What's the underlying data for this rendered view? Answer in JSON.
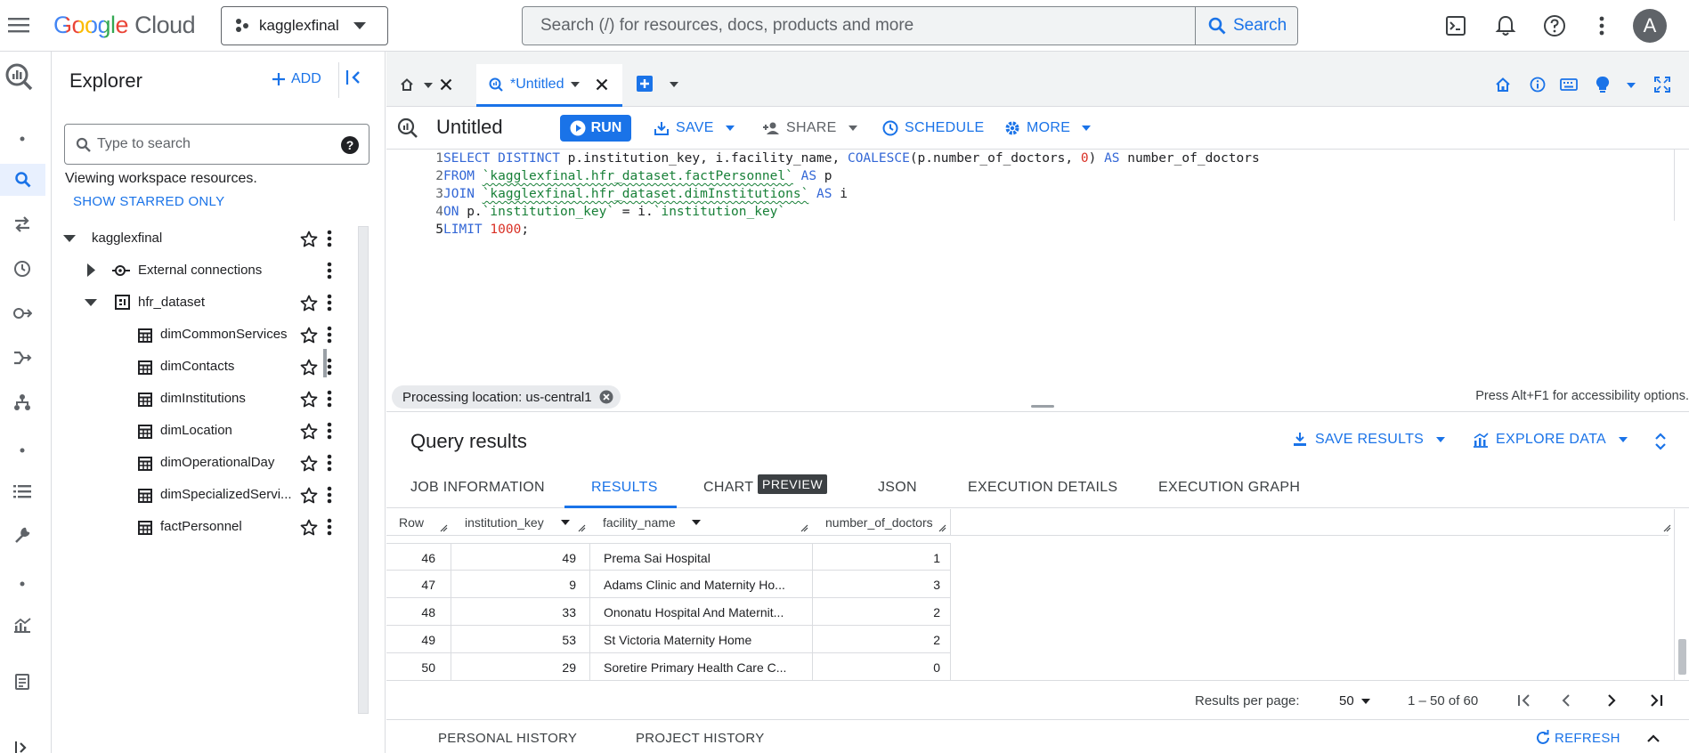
{
  "colors": {
    "accent": "#1a73e8",
    "text": "#202124",
    "muted": "#5f6368",
    "border": "#dadce0"
  },
  "header": {
    "logo_google": "Google",
    "logo_cloud": "Cloud",
    "project": "kagglexfinal",
    "search_placeholder": "Search (/) for resources, docs, products and more",
    "search_button": "Search",
    "avatar_letter": "A"
  },
  "explorer": {
    "title": "Explorer",
    "add_label": "ADD",
    "search_placeholder": "Type to search",
    "viewing_text": "Viewing workspace resources.",
    "starred_label": "SHOW STARRED ONLY",
    "project": "kagglexfinal",
    "external_connections": "External connections",
    "dataset": "hfr_dataset",
    "tables": [
      "dimCommonServices",
      "dimContacts",
      "dimInstitutions",
      "dimLocation",
      "dimOperationalDay",
      "dimSpecializedServi...",
      "factPersonnel"
    ]
  },
  "tabs": {
    "active_label": "*Untitled"
  },
  "toolbar": {
    "title": "Untitled",
    "run": "RUN",
    "save": "SAVE",
    "share": "SHARE",
    "schedule": "SCHEDULE",
    "more": "MORE"
  },
  "code": {
    "line_numbers": [
      "1",
      "2",
      "3",
      "4",
      "5"
    ]
  },
  "status": {
    "processing_location": "Processing location: us-central1",
    "accessibility_hint": "Press Alt+F1 for accessibility options."
  },
  "results": {
    "title": "Query results",
    "save_results": "SAVE RESULTS",
    "explore_data": "EXPLORE DATA",
    "tabs": [
      "JOB INFORMATION",
      "RESULTS",
      "CHART",
      "JSON",
      "EXECUTION DETAILS",
      "EXECUTION GRAPH"
    ],
    "preview_badge": "PREVIEW",
    "columns": [
      "Row",
      "institution_key",
      "facility_name",
      "number_of_doctors"
    ],
    "rows": [
      [
        "46",
        "49",
        "Prema Sai Hospital",
        "1"
      ],
      [
        "47",
        "9",
        "Adams Clinic and Maternity Ho...",
        "3"
      ],
      [
        "48",
        "33",
        "Ononatu Hospital And Maternit...",
        "2"
      ],
      [
        "49",
        "53",
        "St Victoria Maternity Home",
        "2"
      ],
      [
        "50",
        "29",
        "Soretire Primary Health Care C...",
        "0"
      ]
    ],
    "pager": {
      "per_page_label": "Results per page:",
      "per_page_value": "50",
      "range": "1 – 50 of 60"
    },
    "history": {
      "personal": "PERSONAL HISTORY",
      "project": "PROJECT HISTORY",
      "refresh": "REFRESH"
    }
  }
}
